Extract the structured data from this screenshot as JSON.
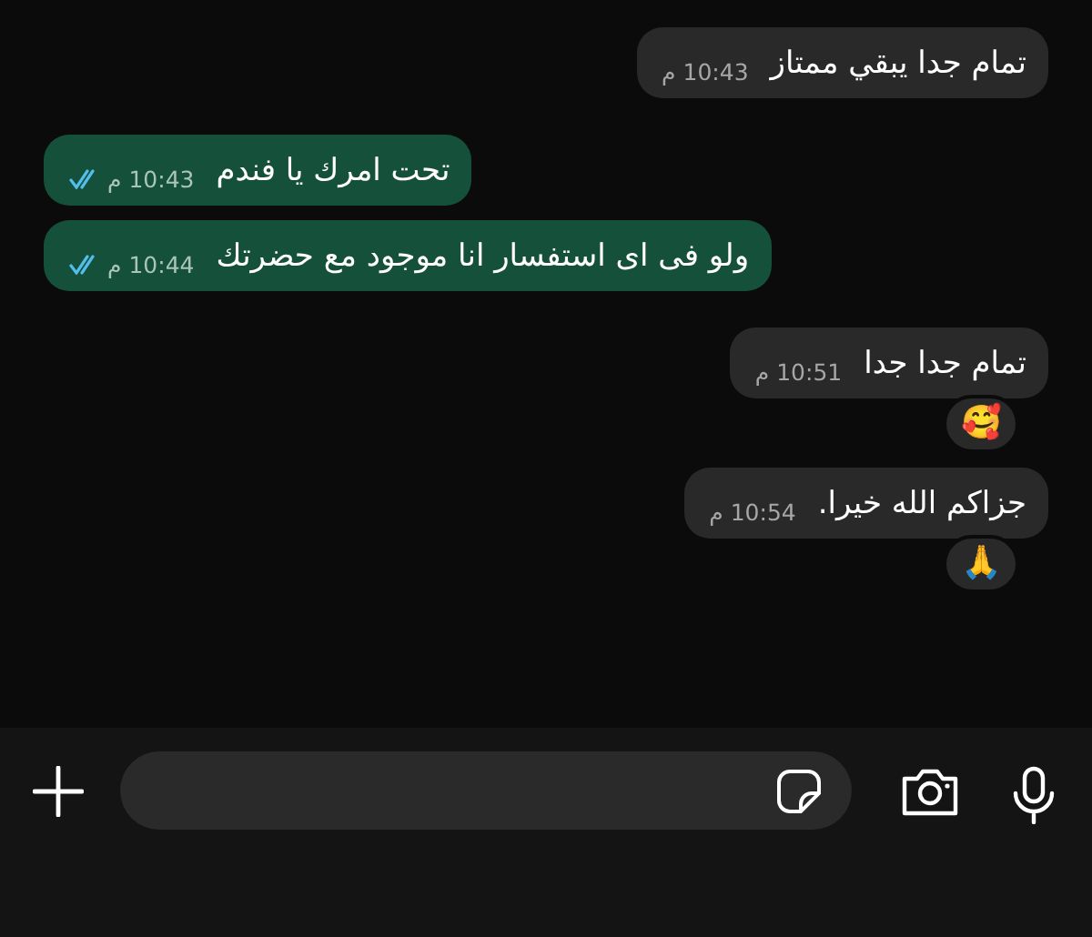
{
  "messages": [
    {
      "kind": "in",
      "text": "تمام جدا يبقي ممتاز",
      "time": "10:43 م"
    },
    {
      "kind": "out",
      "text": "تحت امرك يا فندم",
      "time": "10:43 م",
      "read": true
    },
    {
      "kind": "out",
      "text": "ولو فى اى استفسار انا موجود مع حضرتك",
      "time": "10:44 م",
      "read": true
    },
    {
      "kind": "in",
      "text": "تمام جدا جدا",
      "time": "10:51 م",
      "reaction": "🥰"
    },
    {
      "kind": "in",
      "text": "جزاكم الله خيرا.",
      "time": "10:54 م",
      "reaction": "🙏"
    }
  ]
}
